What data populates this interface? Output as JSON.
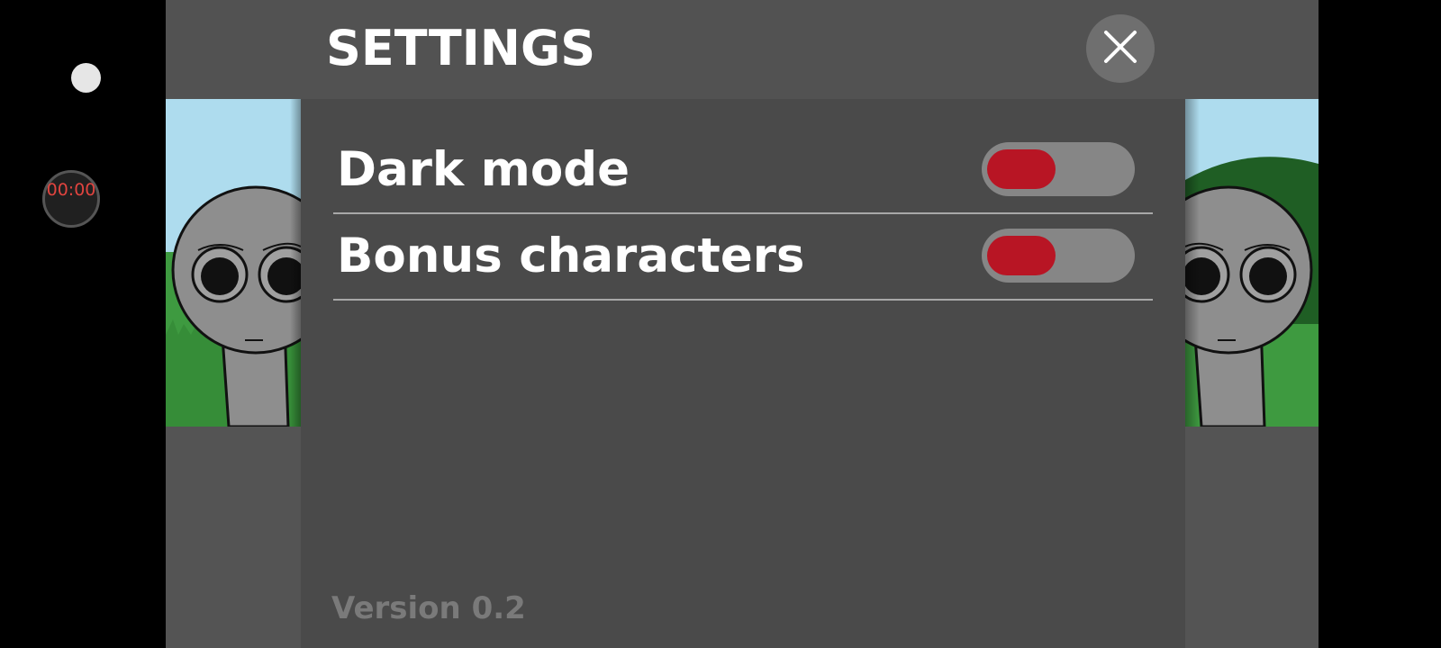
{
  "screen_recorder": {
    "timer_text": "00:00"
  },
  "settings": {
    "title": "SETTINGS",
    "close_icon": "close-icon",
    "options": [
      {
        "label": "Dark mode",
        "enabled": false
      },
      {
        "label": "Bonus characters",
        "enabled": false
      }
    ],
    "version": "Version 0.2"
  },
  "colors": {
    "background": "#525252",
    "panel": "#4a4a4a",
    "toggle_track": "#868686",
    "toggle_knob_off": "#b81524",
    "text": "#ffffff",
    "version_text": "#7a7a7a"
  }
}
